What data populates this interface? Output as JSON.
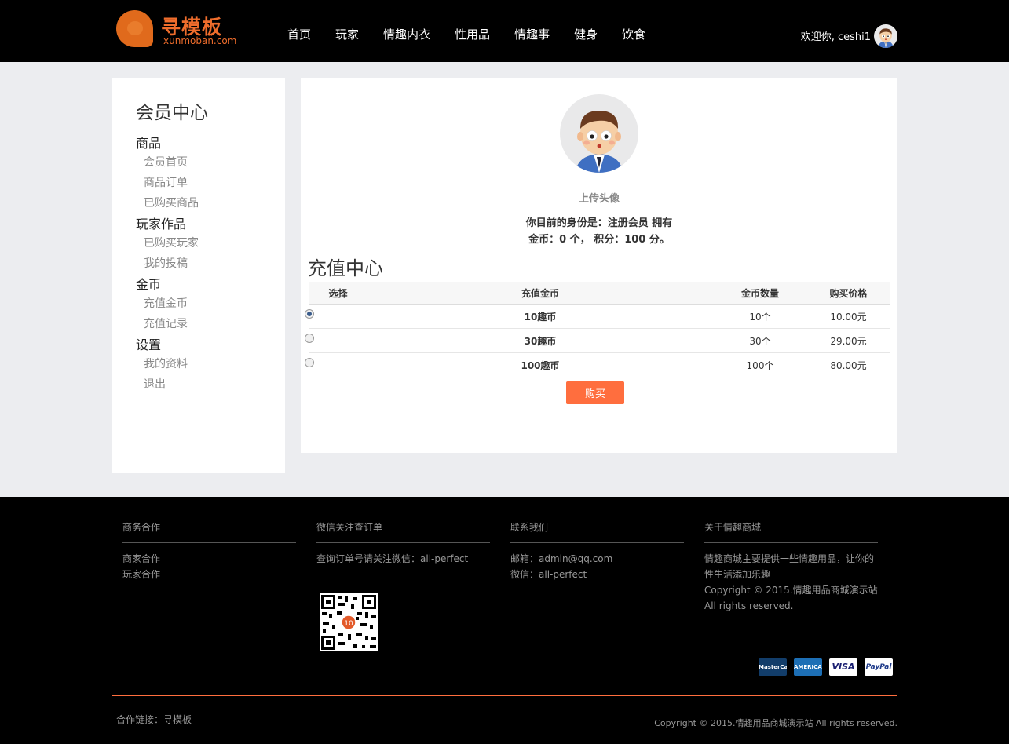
{
  "header": {
    "logo": {
      "text_cn": "寻模板",
      "text_en": "xunmoban.com"
    },
    "nav": [
      "首页",
      "玩家",
      "情趣内衣",
      "性用品",
      "情趣事",
      "健身",
      "饮食"
    ],
    "welcome": "欢迎你, ceshi1"
  },
  "sidebar": {
    "title": "会员中心",
    "groups": [
      {
        "label": "商品",
        "items": [
          "会员首页",
          "商品订单",
          "已购买商品"
        ]
      },
      {
        "label": "玩家作品",
        "items": [
          "已购买玩家",
          "我的投稿"
        ]
      },
      {
        "label": "金币",
        "items": [
          "充值金币",
          "充值记录"
        ]
      },
      {
        "label": "设置",
        "items": [
          "我的资料",
          "退出"
        ]
      }
    ]
  },
  "main": {
    "upload_label": "上传头像",
    "identity_line1": "你目前的身份是：注册会员 拥有",
    "identity_line2": "金币：0 个， 积分：100 分。",
    "recharge_title": "充值中心",
    "table": {
      "headers": [
        "选择",
        "充值金币",
        "金币数量",
        "购买价格"
      ],
      "rows": [
        {
          "selected": true,
          "coins": "10趣币",
          "qty": "10个",
          "price": "10.00元"
        },
        {
          "selected": false,
          "coins": "30趣币",
          "qty": "30个",
          "price": "29.00元"
        },
        {
          "selected": false,
          "coins": "100趣币",
          "qty": "100个",
          "price": "80.00元"
        }
      ]
    },
    "buy_label": "购买"
  },
  "footer": {
    "columns": [
      {
        "title": "商务合作",
        "lines": [
          "商家合作",
          "玩家合作"
        ]
      },
      {
        "title": "微信关注查订单",
        "lines": [
          "查询订单号请关注微信：all-perfect"
        ]
      },
      {
        "title": "联系我们",
        "lines": [
          "邮箱：admin@qq.com",
          "微信：all-perfect"
        ]
      },
      {
        "title": "关于情趣商城",
        "lines": [
          "情趣商城主要提供一些情趣用品，让你的性生活添加乐趣",
          "Copyright © 2015.情趣用品商城演示站 All rights reserved."
        ]
      }
    ],
    "qr_badge": "10",
    "payment_cards": [
      "MasterCard",
      "AMERICAN EXPRESS",
      "VISA",
      "PayPal"
    ],
    "partner": "合作链接：寻模板",
    "copyright": "Copyright © 2015.情趣用品商城演示站 All rights reserved."
  },
  "colors": {
    "accent": "#ff6e3e",
    "header_bg": "#000000",
    "page_bg": "#ecedf0"
  },
  "icons": {
    "avatar": "cartoon-man-avatar-icon",
    "qr": "qr-code-icon",
    "radio": "radio-button"
  }
}
